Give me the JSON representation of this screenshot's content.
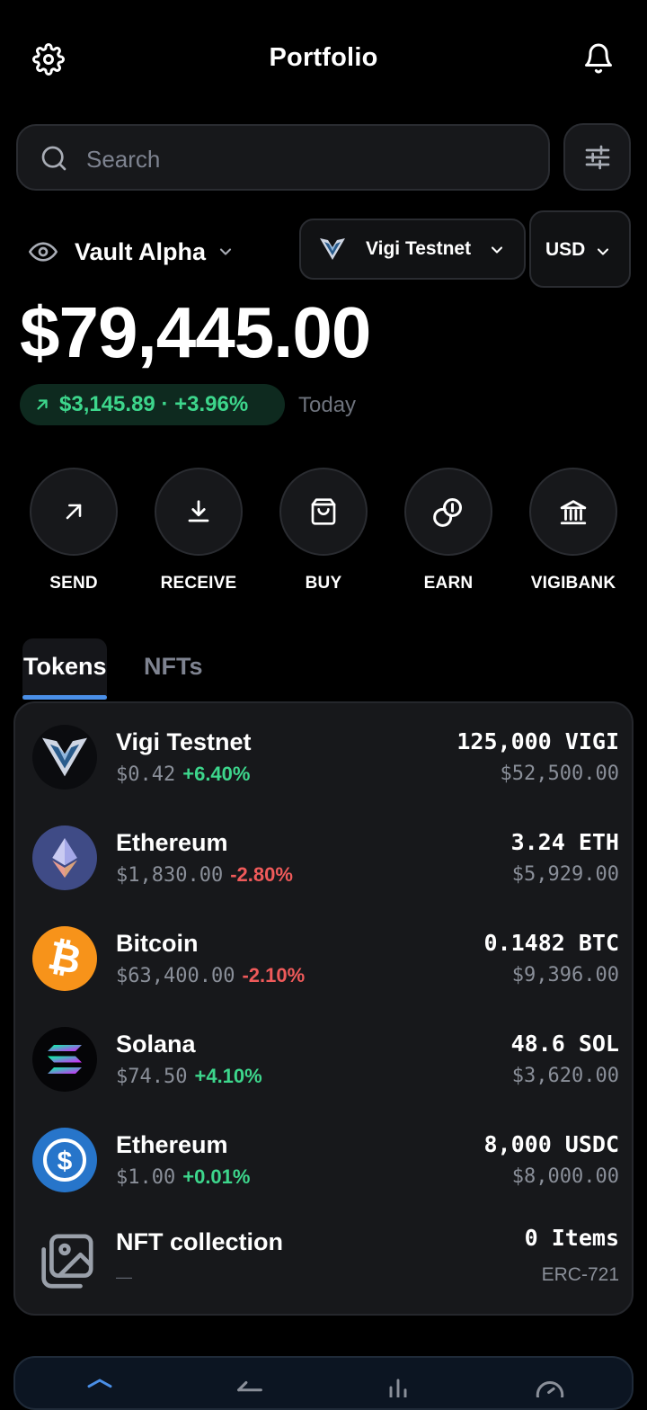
{
  "header": {
    "title": "Portfolio",
    "settings_icon": "gear-icon",
    "notifications_icon": "bell-icon"
  },
  "search": {
    "placeholder": "Search"
  },
  "vault": {
    "name": "Vault Alpha",
    "visibility_icon": "eye-icon"
  },
  "network": {
    "label": "Vigi Testnet"
  },
  "currency": {
    "label": "USD"
  },
  "balance": {
    "amount": "$79,445.00",
    "change": "$3,145.89 · +3.96%",
    "period": "Today"
  },
  "actions": [
    {
      "label": "SEND",
      "icon": "arrow-up-right-icon"
    },
    {
      "label": "RECEIVE",
      "icon": "download-icon"
    },
    {
      "label": "BUY",
      "icon": "shopping-bag-icon"
    },
    {
      "label": "EARN",
      "icon": "coins-icon"
    },
    {
      "label": "VIGIBANK",
      "icon": "bank-icon"
    }
  ],
  "tabs": [
    {
      "label": "Tokens",
      "active": true
    },
    {
      "label": "NFTs",
      "active": false
    }
  ],
  "tokens": [
    {
      "name": "Vigi Testnet",
      "price": "$0.42",
      "change": "+6.40%",
      "amount": "125,000 VIGI",
      "value": "$52,500.00",
      "icon": "vigi-logo-icon"
    },
    {
      "name": "Ethereum",
      "price": "$1,830.00",
      "change": "-2.80%",
      "amount": "3.24 ETH",
      "value": "$5,929.00",
      "icon": "ethereum-icon"
    },
    {
      "name": "Bitcoin",
      "price": "$63,400.00",
      "change": "-2.10%",
      "amount": "0.1482 BTC",
      "value": "$9,396.00",
      "icon": "bitcoin-icon"
    },
    {
      "name": "Solana",
      "price": "$74.50",
      "change": "+4.10%",
      "amount": "48.6 SOL",
      "value": "$3,620.00",
      "icon": "solana-icon"
    },
    {
      "name": "Ethereum",
      "price": "$1.00",
      "change": "+0.01%",
      "amount": "8,000 USDC",
      "value": "$8,000.00",
      "icon": "usdc-icon"
    },
    {
      "name": "NFT collection",
      "price": "—",
      "change": "",
      "amount": "0 Items",
      "value": "ERC-721",
      "icon": "image-gallery-icon"
    }
  ],
  "colors": {
    "positive": "#3dd68c",
    "negative": "#ef5a5a",
    "accent": "#4a8fe7",
    "background": "#000000",
    "card": "#17181b"
  }
}
